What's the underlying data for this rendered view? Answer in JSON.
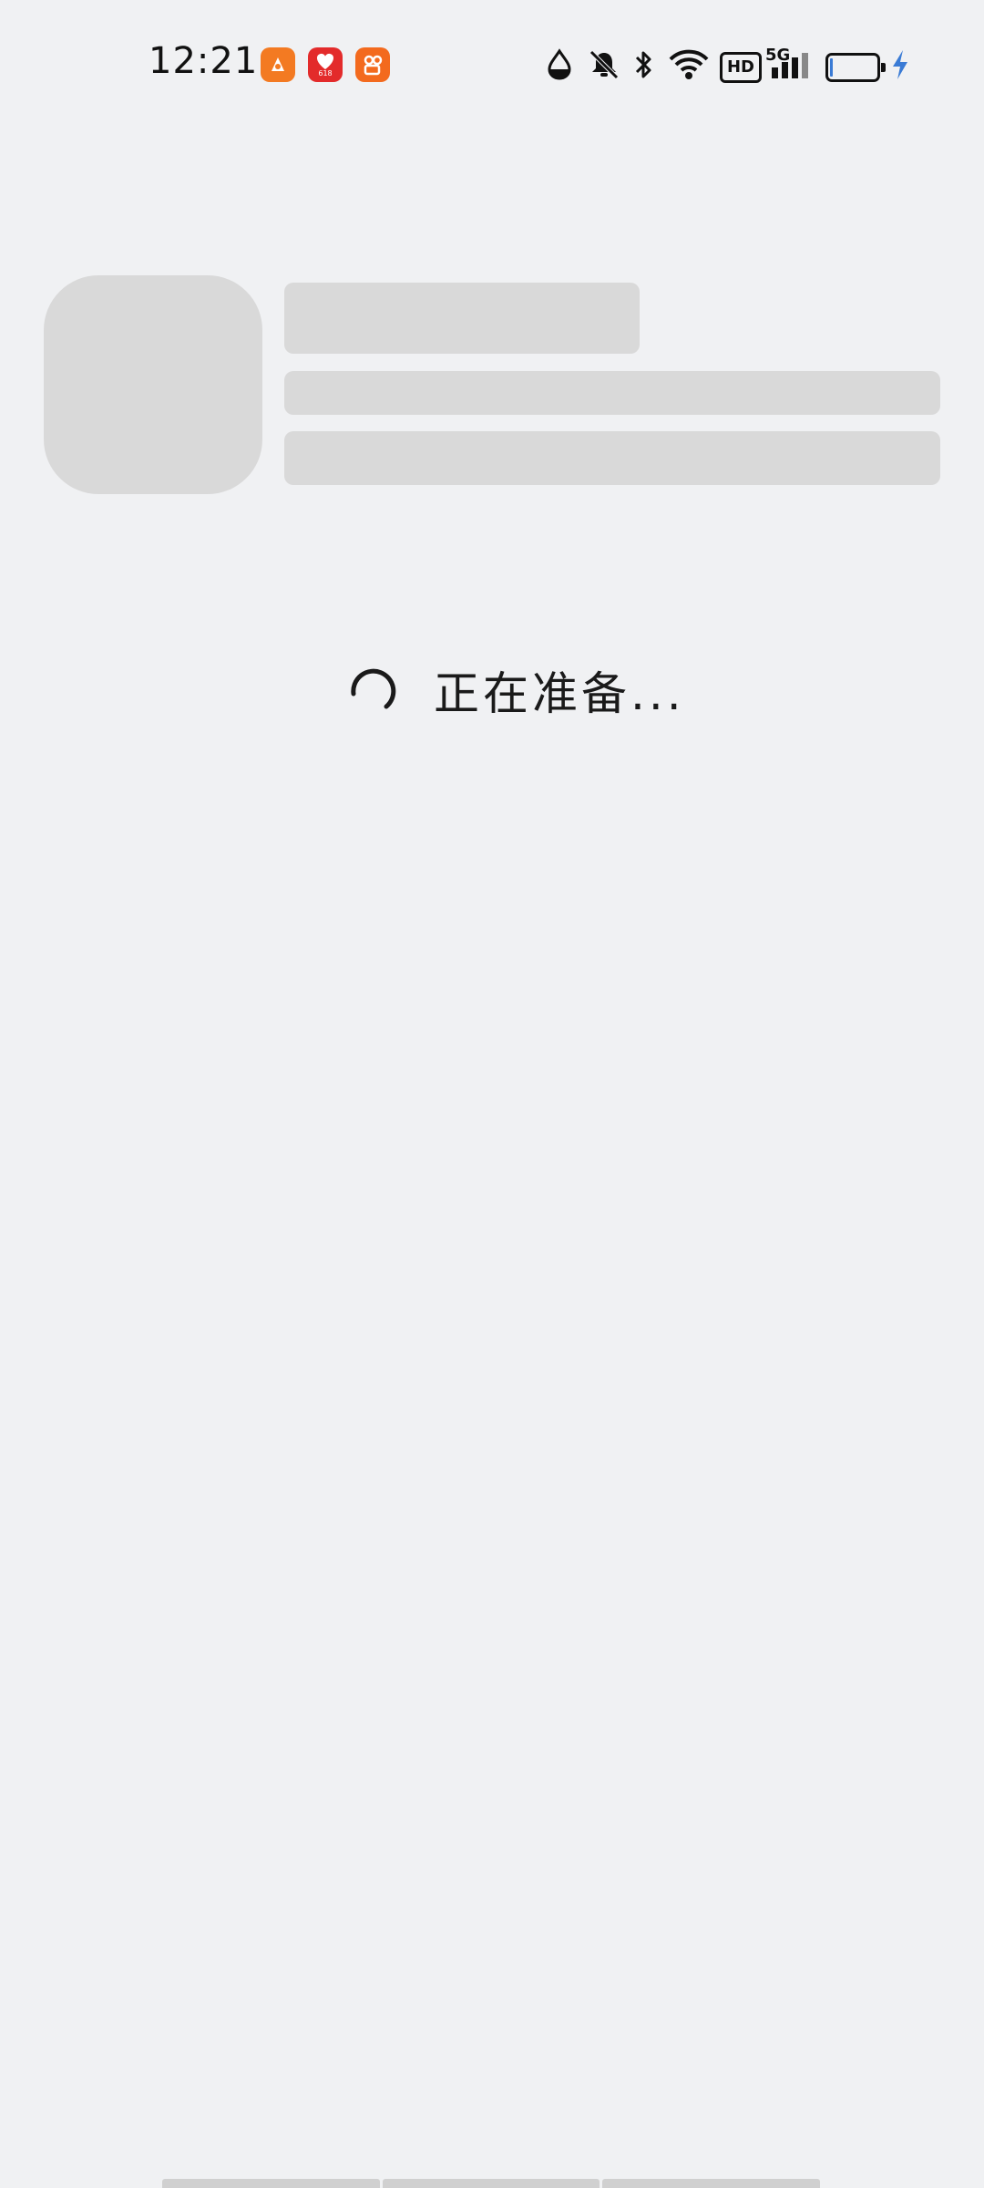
{
  "status_bar": {
    "time": "12:21",
    "notification_icons": [
      "orange-app-icon",
      "red-heart-app-icon",
      "orange-video-app-icon"
    ],
    "right_icons": [
      "water-drop-icon",
      "mute-bell-icon",
      "bluetooth-icon",
      "wifi-icon",
      "hd-badge",
      "signal-5g-icon",
      "battery-icon",
      "charging-icon"
    ],
    "hd_label": "HD",
    "network_label": "5G",
    "app_badge_text": "618"
  },
  "loading": {
    "text": "正在准备..."
  },
  "colors": {
    "background": "#f0f1f3",
    "skeleton": "#d9d9d9",
    "charging": "#3a7bd5"
  }
}
